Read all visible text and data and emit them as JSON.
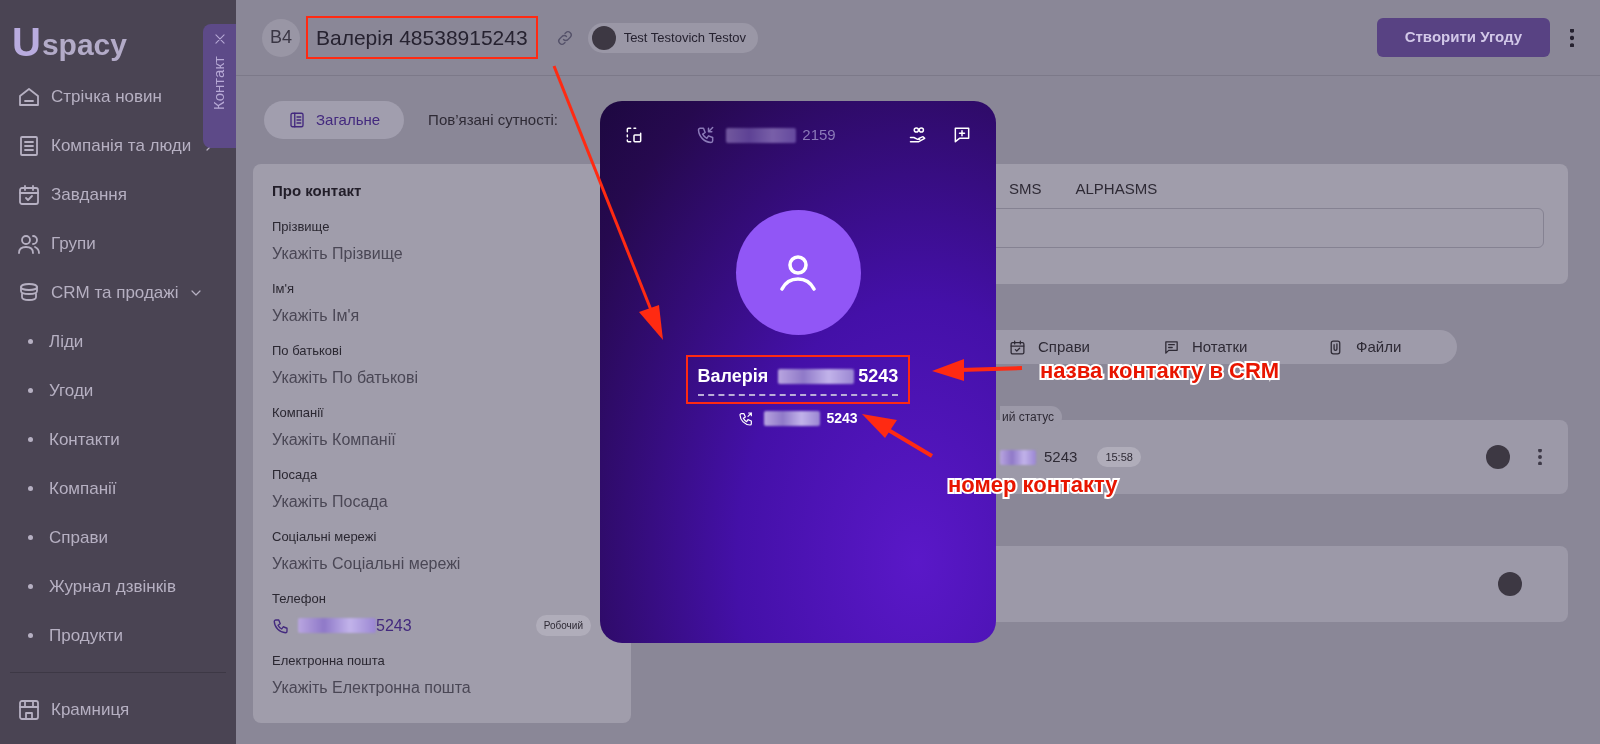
{
  "sidebar": {
    "logo": {
      "mark": "U",
      "text": "spacy"
    },
    "items": [
      {
        "kind": "link",
        "label": "Стрічка новин"
      },
      {
        "kind": "group",
        "label": "Компанія та люди",
        "expanded": false
      },
      {
        "kind": "link",
        "label": "Завдання"
      },
      {
        "kind": "link",
        "label": "Групи"
      },
      {
        "kind": "group",
        "label": "CRM та продажі",
        "expanded": true
      },
      {
        "kind": "subitem",
        "label": "Ліди"
      },
      {
        "kind": "subitem",
        "label": "Угоди"
      },
      {
        "kind": "subitem",
        "label": "Контакти"
      },
      {
        "kind": "subitem",
        "label": "Компанії"
      },
      {
        "kind": "subitem",
        "label": "Справи"
      },
      {
        "kind": "subitem",
        "label": "Журнал дзвінків"
      },
      {
        "kind": "subitem",
        "label": "Продукти"
      },
      {
        "kind": "divider"
      },
      {
        "kind": "link",
        "label": "Крамниця"
      }
    ]
  },
  "contact_tab": {
    "label": "Контакт"
  },
  "header": {
    "avatar": "В4",
    "title": "Валерія 48538915243",
    "user": "Test Testovich Testov",
    "primary_button": "Створити Угоду"
  },
  "tabs": [
    {
      "label": "Загальне",
      "selected": true
    },
    {
      "label": "Пов’язані сутності:",
      "selected": false
    }
  ],
  "about": {
    "title": "Про контакт",
    "fields": [
      {
        "kind": "text",
        "label": "Прізвище",
        "placeholder": "Укажіть Прізвище"
      },
      {
        "kind": "text",
        "label": "Ім'я",
        "placeholder": "Укажіть Ім'я"
      },
      {
        "kind": "text",
        "label": "По батькові",
        "placeholder": "Укажіть По батькові"
      },
      {
        "kind": "text",
        "label": "Компанії",
        "placeholder": "Укажіть Компанії"
      },
      {
        "kind": "text",
        "label": "Посада",
        "placeholder": "Укажіть Посада"
      },
      {
        "kind": "text",
        "label": "Соціальні мережі",
        "placeholder": "Укажіть Соціальні мережі"
      },
      {
        "kind": "phone",
        "label": "Телефон",
        "value": "5243",
        "tag": "Робочий"
      },
      {
        "kind": "text",
        "label": "Електронна пошта",
        "placeholder": "Укажіть Електронна пошта"
      }
    ]
  },
  "composer": {
    "tabs": [
      "SMS",
      "ALPHASMS"
    ]
  },
  "activity_tabs": [
    "Справи",
    "Нотатки",
    "Файли"
  ],
  "feed": {
    "status_label": "ий статус",
    "entry": {
      "number": "5243",
      "time": "15:58"
    }
  },
  "call_popup": {
    "number": "2159",
    "name": "Валерія",
    "name_suffix": "5243",
    "phone": "5243"
  },
  "annotations": [
    {
      "text": "назва контакту в CRM"
    },
    {
      "text": "номер контакту"
    }
  ]
}
